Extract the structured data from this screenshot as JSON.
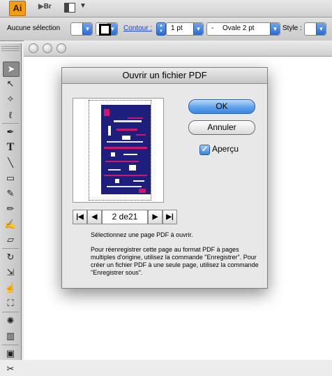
{
  "app": {
    "logo_text": "Ai",
    "bridge_label": "Br"
  },
  "control_bar": {
    "selection_label": "Aucune sélection",
    "stroke_label": "Contour :",
    "stroke_weight": "1 pt",
    "brush_prefix": "-",
    "brush_name": "Ovale 2 pt",
    "style_label": "Style :"
  },
  "dialog": {
    "title": "Ouvrir un fichier PDF",
    "page_field": "2 de21",
    "ok_label": "OK",
    "cancel_label": "Annuler",
    "preview_label": "Aperçu",
    "preview_checked": true,
    "instruction": "Sélectionnez une page PDF à ouvrir.",
    "info": "Pour réenregistrer cette page au format PDF à pages multiples d'origine, utilisez la commande \"Enregistrer\". Pour créer un fichier PDF à une seule page, utilisez la commande \"Enregistrer sous\".",
    "nav_first": "first-page-icon",
    "nav_prev": "previous-page-icon",
    "nav_next": "next-page-icon",
    "nav_last": "last-page-icon"
  },
  "tools": [
    "selection-tool-icon",
    "direct-selection-tool-icon",
    "magic-wand-tool-icon",
    "lasso-tool-icon",
    "pen-tool-icon",
    "type-tool-icon",
    "line-tool-icon",
    "rectangle-tool-icon",
    "paintbrush-tool-icon",
    "pencil-tool-icon",
    "blob-brush-tool-icon",
    "eraser-tool-icon",
    "rotate-tool-icon",
    "scale-tool-icon",
    "warp-tool-icon",
    "free-transform-tool-icon",
    "symbol-sprayer-tool-icon",
    "graph-tool-icon",
    "artboard-tool-icon",
    "slice-tool-icon"
  ],
  "colors": {
    "ai_orange": "#f29d19",
    "ok_blue": "#5ea1ec",
    "thumb_navy": "#1e1f7d",
    "thumb_magenta": "#c8196e"
  }
}
